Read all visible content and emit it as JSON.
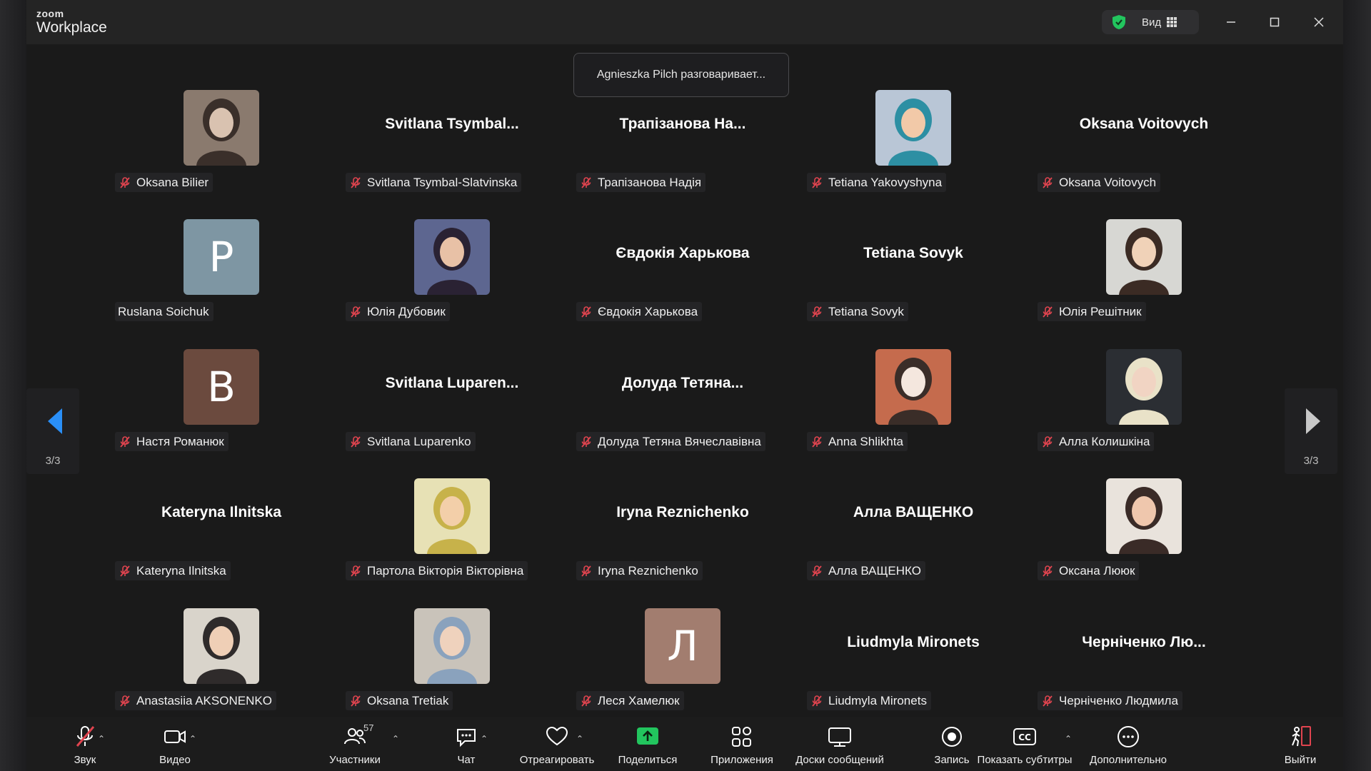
{
  "app": {
    "brand_top": "zoom",
    "brand_bottom": "Workplace"
  },
  "titlebar": {
    "view_label": "Вид"
  },
  "toast": "Agnieszka Pilch разговаривает...",
  "pager": {
    "left": "3/3",
    "right": "3/3"
  },
  "participants": [
    {
      "label": "Oksana Bilier",
      "muted": true,
      "avatar": "photo",
      "name_display": ""
    },
    {
      "label": "Svitlana Tsymbal-Slatvinska",
      "muted": true,
      "avatar": "none",
      "name_display": "Svitlana  Tsymbal..."
    },
    {
      "label": "Трапізанова Надія",
      "muted": true,
      "avatar": "none",
      "name_display": "Трапізанова  На..."
    },
    {
      "label": "Tetiana Yakovyshyna",
      "muted": true,
      "avatar": "photo",
      "name_display": ""
    },
    {
      "label": "Oksana Voitovych",
      "muted": true,
      "avatar": "none",
      "name_display": "Oksana Voitovych"
    },
    {
      "label": "Ruslana Soichuk",
      "muted": false,
      "avatar": "letter",
      "letter": "P",
      "letter_color": "#7e96a3",
      "name_display": ""
    },
    {
      "label": "Юлія Дубовик",
      "muted": true,
      "avatar": "photo",
      "name_display": ""
    },
    {
      "label": "Євдокія Харькова",
      "muted": true,
      "avatar": "none",
      "name_display": "Євдокія Харькова"
    },
    {
      "label": "Tetiana Sovyk",
      "muted": true,
      "avatar": "none",
      "name_display": "Tetiana Sovyk"
    },
    {
      "label": "Юлія Решітник",
      "muted": true,
      "avatar": "photo",
      "name_display": ""
    },
    {
      "label": "Настя Романюк",
      "muted": true,
      "avatar": "letter",
      "letter": "B",
      "letter_color": "#6b4a3e",
      "name_display": ""
    },
    {
      "label": "Svitlana Luparenko",
      "muted": true,
      "avatar": "none",
      "name_display": "Svitlana  Luparen..."
    },
    {
      "label": "Долуда Тетяна Вячеславівна",
      "muted": true,
      "avatar": "none",
      "name_display": "Долуда  Тетяна..."
    },
    {
      "label": "Anna Shlikhta",
      "muted": true,
      "avatar": "photo",
      "name_display": ""
    },
    {
      "label": "Алла Колишкіна",
      "muted": true,
      "avatar": "photo",
      "name_display": ""
    },
    {
      "label": "Kateryna Ilnitska",
      "muted": true,
      "avatar": "none",
      "name_display": "Kateryna Ilnitska"
    },
    {
      "label": "Партола Вікторія Вікторівна",
      "muted": true,
      "avatar": "photo",
      "name_display": ""
    },
    {
      "label": "Iryna Reznichenko",
      "muted": true,
      "avatar": "none",
      "name_display": "Iryna Reznichenko"
    },
    {
      "label": "Алла ВАЩЕНКО",
      "muted": true,
      "avatar": "none",
      "name_display": "Алла ВАЩЕНКО"
    },
    {
      "label": "Оксана Лююк",
      "muted": true,
      "avatar": "photo",
      "name_display": ""
    },
    {
      "label": "Anastasiia AKSONENKO",
      "muted": true,
      "avatar": "photo",
      "name_display": ""
    },
    {
      "label": "Oksana Tretiak",
      "muted": true,
      "avatar": "photo",
      "name_display": ""
    },
    {
      "label": "Леся Хамелюк",
      "muted": true,
      "avatar": "letter",
      "letter": "Л",
      "letter_color": "#a27d6f",
      "name_display": ""
    },
    {
      "label": "Liudmyla Mironets",
      "muted": true,
      "avatar": "none",
      "name_display": "Liudmyla Mironets"
    },
    {
      "label": "Черніченко Людмила",
      "muted": true,
      "avatar": "none",
      "name_display": "Черніченко  Лю..."
    }
  ],
  "toolbar": {
    "audio": "Звук",
    "video": "Видео",
    "participants": "Участники",
    "participants_count": "57",
    "chat": "Чат",
    "react": "Отреагировать",
    "share": "Поделиться",
    "apps": "Приложения",
    "whiteboards": "Доски сообщений",
    "record": "Запись",
    "captions": "Показать субтитры",
    "more": "Дополнительно",
    "leave": "Выйти"
  },
  "colors": {
    "mute_red": "#e0444f",
    "share_green": "#22c55e",
    "shield_green": "#22c55e",
    "nav_blue": "#2a8ff7"
  }
}
